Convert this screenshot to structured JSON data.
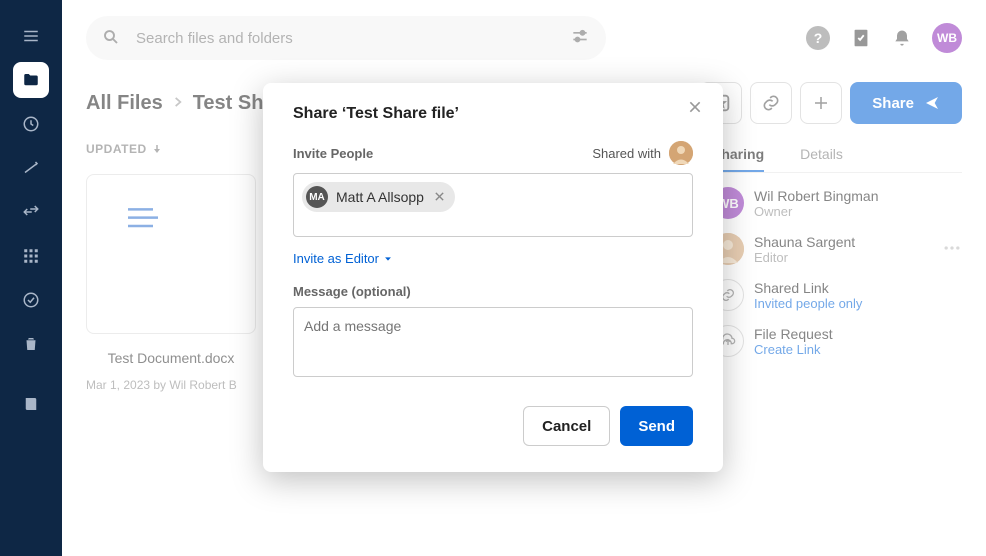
{
  "search": {
    "placeholder": "Search files and folders"
  },
  "user": {
    "initials": "WB"
  },
  "breadcrumb": {
    "root": "All Files",
    "current": "Test Sh"
  },
  "shareButton": "Share",
  "listHeader": "UPDATED",
  "file": {
    "name": "Test Document.docx",
    "meta": "Mar 1, 2023 by Wil Robert B"
  },
  "panel": {
    "tabs": {
      "sharing": "Sharing",
      "details": "Details"
    },
    "people": [
      {
        "name": "Wil Robert Bingman",
        "role": "Owner",
        "initials": "WB"
      },
      {
        "name": "Shauna Sargent",
        "role": "Editor"
      }
    ],
    "sharedLink": {
      "title": "Shared Link",
      "sub": "Invited people only"
    },
    "fileRequest": {
      "title": "File Request",
      "sub": "Create Link"
    }
  },
  "modal": {
    "title": "Share ‘Test Share file’",
    "inviteLabel": "Invite People",
    "sharedWith": "Shared with",
    "chip": {
      "initials": "MA",
      "name": "Matt A Allsopp"
    },
    "roleSelector": "Invite as Editor",
    "messageLabel": "Message (optional)",
    "messagePlaceholder": "Add a message",
    "cancel": "Cancel",
    "send": "Send"
  }
}
